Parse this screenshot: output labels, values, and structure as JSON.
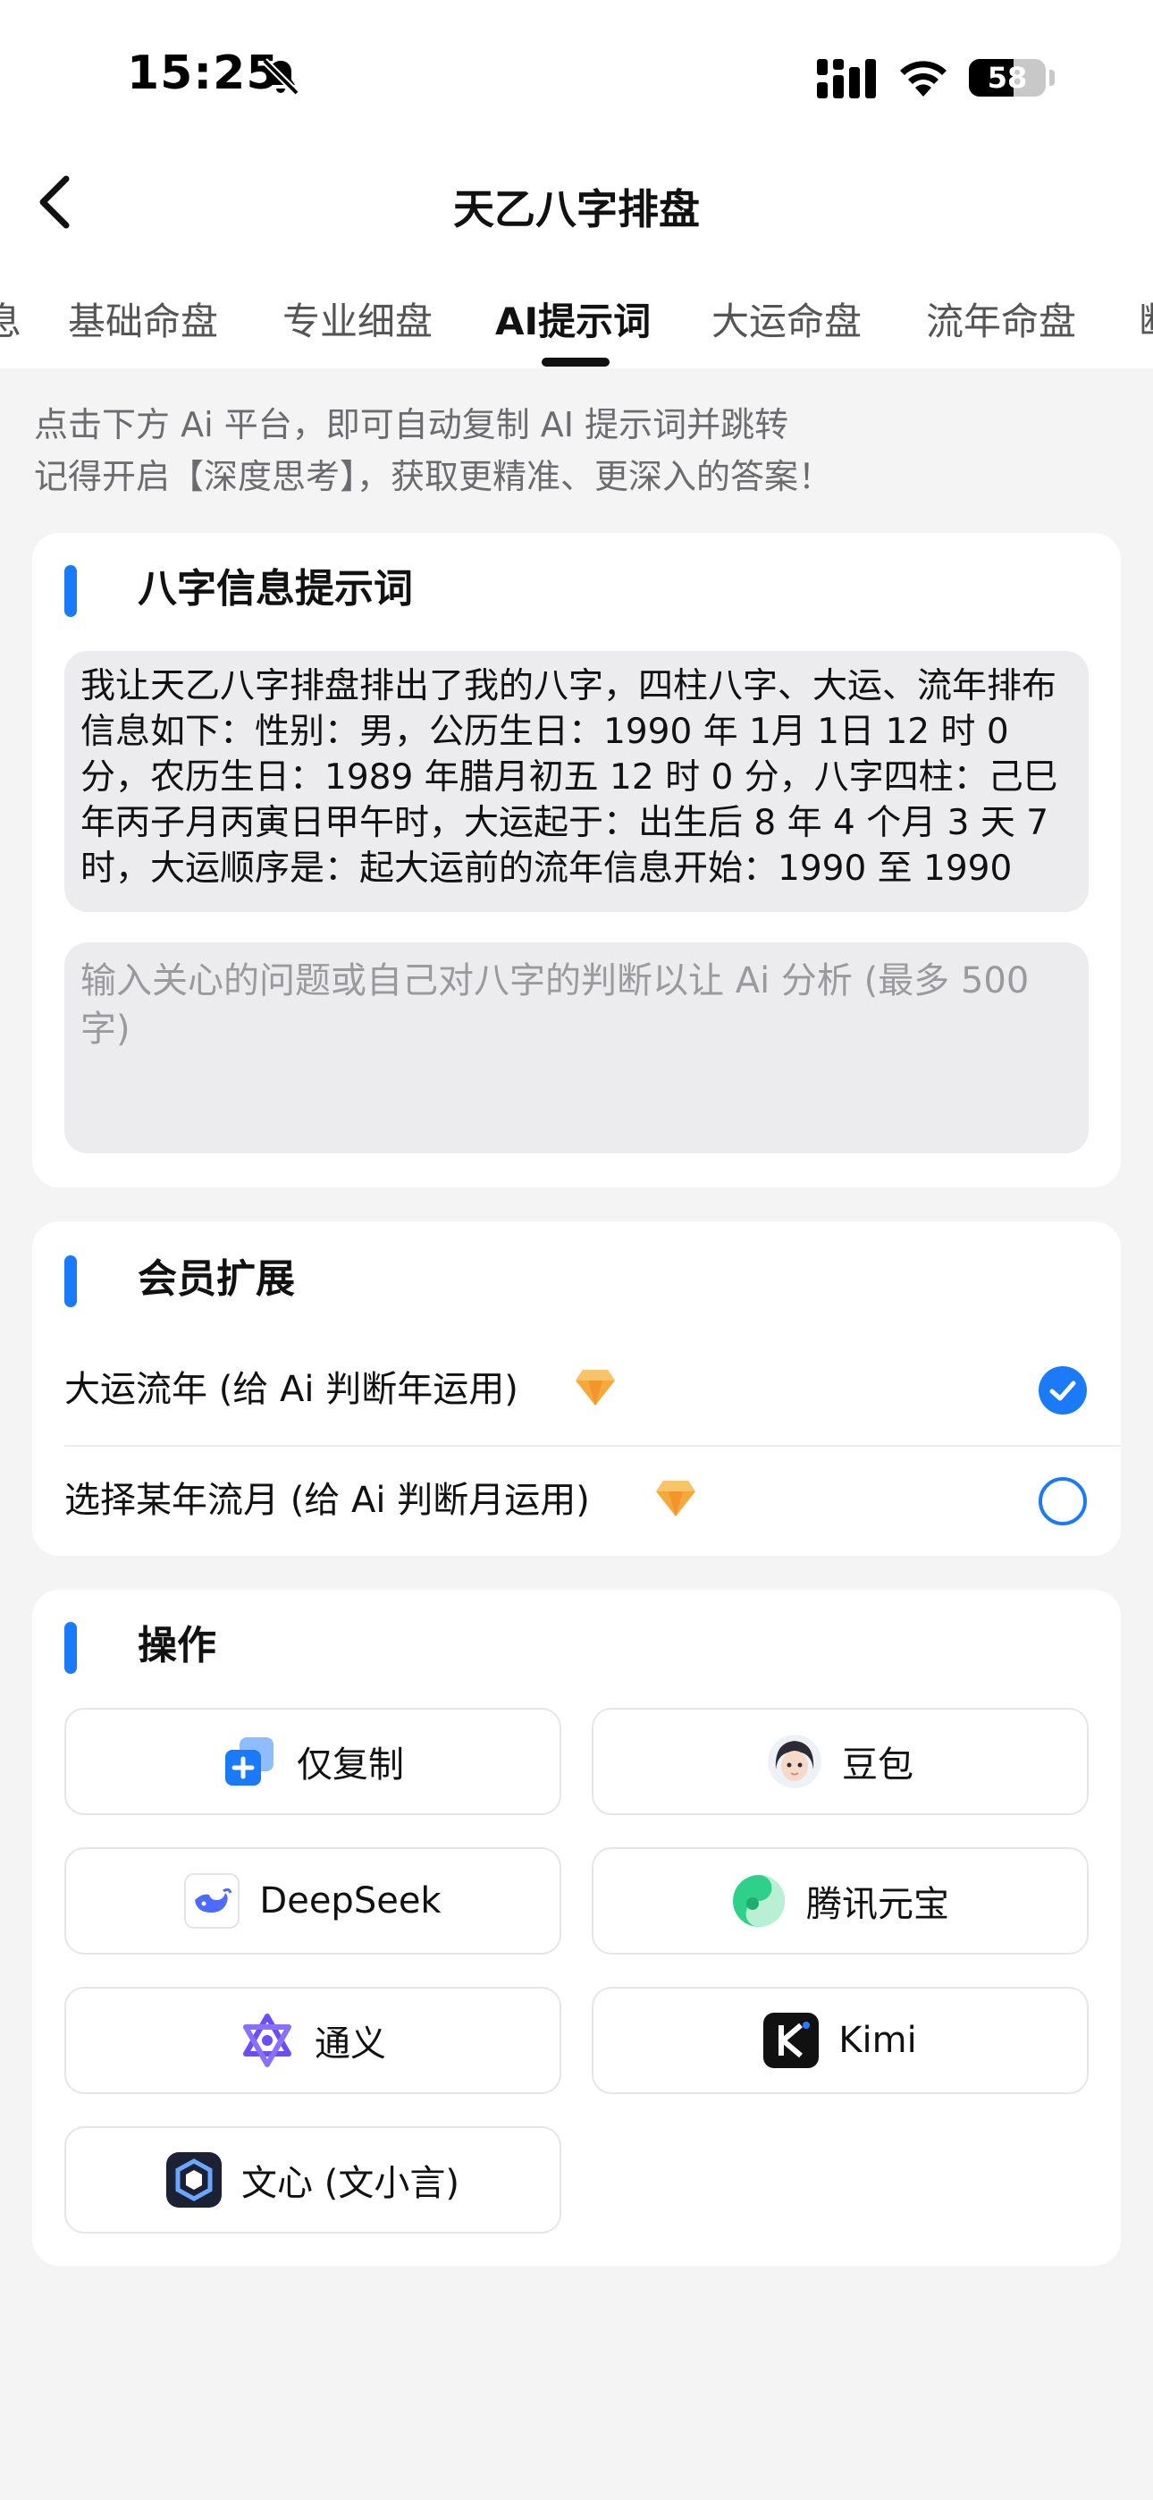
{
  "status_bar": {
    "time": "15:25",
    "battery_level": "58",
    "icons": [
      "bell-slash-icon",
      "signal-icon",
      "wifi-icon",
      "battery-icon"
    ]
  },
  "nav": {
    "title": "天乙八字排盘",
    "back_icon": "chevron-left-icon"
  },
  "tabs": {
    "items": [
      {
        "label": "息"
      },
      {
        "label": "基础命盘"
      },
      {
        "label": "专业细盘"
      },
      {
        "label": "AI提示词"
      },
      {
        "label": "大运命盘"
      },
      {
        "label": "流年命盘"
      },
      {
        "label": "断"
      }
    ],
    "active_index": 3
  },
  "hint": {
    "line1": "点击下方 Ai 平台，即可自动复制 AI 提示词并跳转",
    "line2": "记得开启【深度思考】，获取更精准、更深入的答案！"
  },
  "prompt_section": {
    "title": "八字信息提示词",
    "prompt_text": "我让天乙八字排盘排出了我的八字，四柱八字、大运、流年排布信息如下：性别：男，公历生日：1990 年 1月 1日 12 时 0 分，农历生日：1989 年腊月初五 12 时 0 分，八字四柱：己巳年丙子月丙寅日甲午时，大运起于：出生后 8 年 4 个月 3 天 7时，大运顺序是：起大运前的流年信息开始：1990 至 1990",
    "input_value": "",
    "input_placeholder": "输入关心的问题或自己对八字的判断以让 Ai 分析 (最多 500字)"
  },
  "member_section": {
    "title": "会员扩展",
    "options": [
      {
        "label": "大运流年 (给 Ai 判断年运用)",
        "icon": "diamond-icon",
        "checked": true
      },
      {
        "label": "选择某年流月 (给 Ai 判断月运用)",
        "icon": "diamond-icon",
        "checked": false
      }
    ]
  },
  "actions_section": {
    "title": "操作",
    "buttons": [
      {
        "label": "仅复制",
        "icon": "copy-icon"
      },
      {
        "label": "豆包",
        "icon": "doubao-avatar-icon"
      },
      {
        "label": "DeepSeek",
        "icon": "deepseek-whale-icon"
      },
      {
        "label": "腾讯元宝",
        "icon": "yuanbao-icon"
      },
      {
        "label": "通义",
        "icon": "tongyi-icon"
      },
      {
        "label": "Kimi",
        "icon": "kimi-icon"
      },
      {
        "label": "文心 (文小言)",
        "icon": "wenxin-icon"
      }
    ]
  },
  "colors": {
    "accent": "#1a7af8",
    "background": "#f4f4f5",
    "card": "#ffffff",
    "input_bg": "#ececee",
    "gem": "#f5a93a"
  }
}
